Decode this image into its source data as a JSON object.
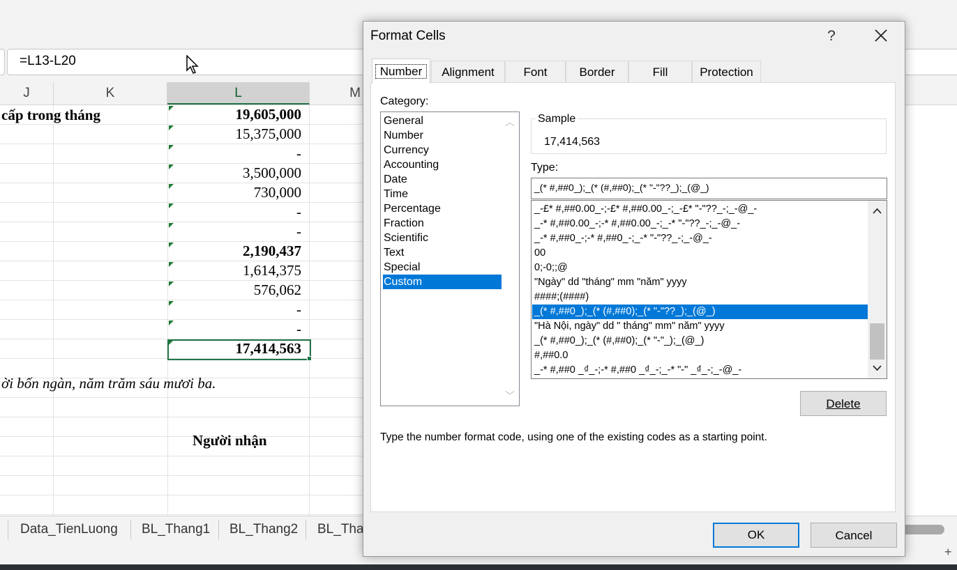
{
  "formula_bar": {
    "formula": "=L13-L20"
  },
  "columns": [
    "J",
    "K",
    "L",
    "M"
  ],
  "sheet": {
    "row_heading": "cấp trong tháng",
    "values": [
      {
        "text": "19,605,000",
        "bold": true
      },
      {
        "text": "15,375,000",
        "bold": false
      },
      {
        "text": "-",
        "bold": false
      },
      {
        "text": "3,500,000",
        "bold": false
      },
      {
        "text": "730,000",
        "bold": false
      },
      {
        "text": "-",
        "bold": false
      },
      {
        "text": "-",
        "bold": false
      },
      {
        "text": "2,190,437",
        "bold": true
      },
      {
        "text": "1,614,375",
        "bold": false
      },
      {
        "text": "576,062",
        "bold": false
      },
      {
        "text": "-",
        "bold": false
      },
      {
        "text": "-",
        "bold": false
      },
      {
        "text": "17,414,563",
        "bold": true
      }
    ],
    "words_line": "ời bốn ngàn, năm trăm sáu mươi ba.",
    "receiver_label": "Người nhận"
  },
  "sheet_tabs": [
    "Data_TienLuong",
    "BL_Thang1",
    "BL_Thang2",
    "BL_Thang"
  ],
  "dialog": {
    "title": "Format Cells",
    "help": "?",
    "tabs": [
      "Number",
      "Alignment",
      "Font",
      "Border",
      "Fill",
      "Protection"
    ],
    "active_tab": "Number",
    "category_label": "Category:",
    "categories": [
      "General",
      "Number",
      "Currency",
      "Accounting",
      "Date",
      "Time",
      "Percentage",
      "Fraction",
      "Scientific",
      "Text",
      "Special",
      "Custom"
    ],
    "selected_category": "Custom",
    "sample_label": "Sample",
    "sample_value": "17,414,563",
    "type_label": "Type:",
    "type_value": "_(* #,##0_);_(* (#,##0);_(* \"-\"??_);_(@_)",
    "formats": [
      "_-£* #,##0.00_-;-£* #,##0.00_-;_-£* \"-\"??_-;_-@_-",
      "_-* #,##0.00_-;-* #,##0.00_-;_-* \"-\"??_-;_-@_-",
      "_-* #,##0_-;-* #,##0_-;_-* \"-\"??_-;_-@_-",
      "00",
      "0;-0;;@",
      "\"Ngày\" dd \"tháng\" mm \"năm\" yyyy",
      "####;(####)",
      "_(* #,##0_);_(* (#,##0);_(* \"-\"??_);_(@_)",
      "\"Hà Nội, ngày\" dd \" tháng\" mm\" năm\" yyyy",
      "_(* #,##0_);_(* (#,##0);_(* \"-\"_);_(@_)",
      "#,##0.0",
      "_-* #,##0 _₫_-;-* #,##0 _₫_-;_-* \"-\" _₫_-;_-@_-"
    ],
    "selected_format_index": 7,
    "delete_button": "Delete",
    "hint": "Type the number format code, using one of the existing codes as a starting point.",
    "ok_button": "OK",
    "cancel_button": "Cancel"
  },
  "colors": {
    "selection": "#0078d7",
    "excel_green": "#217346"
  }
}
